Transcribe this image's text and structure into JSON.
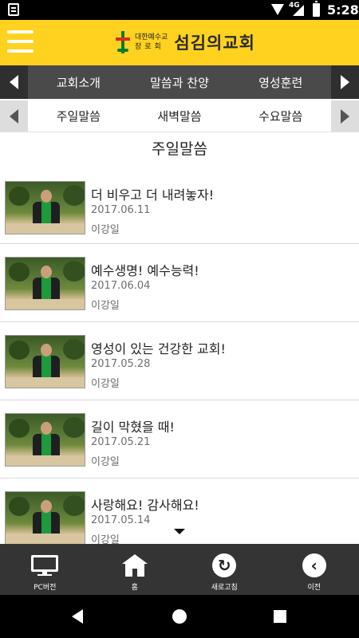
{
  "status_bar": {
    "network": "4G",
    "time": "5:28"
  },
  "header": {
    "logo_small_line1": "대한예수교",
    "logo_small_line2": "장로회",
    "logo_name": "섬김의교회"
  },
  "nav_main": {
    "items": [
      {
        "label": "교회소개"
      },
      {
        "label": "말씀과 찬양"
      },
      {
        "label": "영성훈련"
      }
    ]
  },
  "nav_sub": {
    "items": [
      {
        "label": "주일말씀"
      },
      {
        "label": "새벽말씀"
      },
      {
        "label": "수요말씀"
      }
    ]
  },
  "page": {
    "title": "주일말씀"
  },
  "sermons": [
    {
      "title": "더 비우고 더 내려놓자!",
      "date": "2017.06.11",
      "author": "이강일"
    },
    {
      "title": "예수생명! 예수능력!",
      "date": "2017.06.04",
      "author": "이강일"
    },
    {
      "title": "영성이 있는 건강한 교회!",
      "date": "2017.05.28",
      "author": "이강일"
    },
    {
      "title": "길이 막혔을 때!",
      "date": "2017.05.21",
      "author": "이강일"
    },
    {
      "title": "사랑해요! 감사해요!",
      "date": "2017.05.14",
      "author": "이강일"
    }
  ],
  "toolbar": {
    "pc_label": "PC버전",
    "home_label": "홈",
    "refresh_label": "새로고침",
    "back_label": "이전"
  },
  "colors": {
    "header_yellow": "#FFD21F",
    "nav_dark": "#4a4a4a",
    "toolbar_dark": "#343434",
    "stole_green": "#1e9a3a"
  },
  "icons": {
    "menu": "hamburger-icon",
    "pc": "monitor-icon",
    "home": "home-icon",
    "refresh": "refresh-icon",
    "back": "back-circle-icon"
  }
}
